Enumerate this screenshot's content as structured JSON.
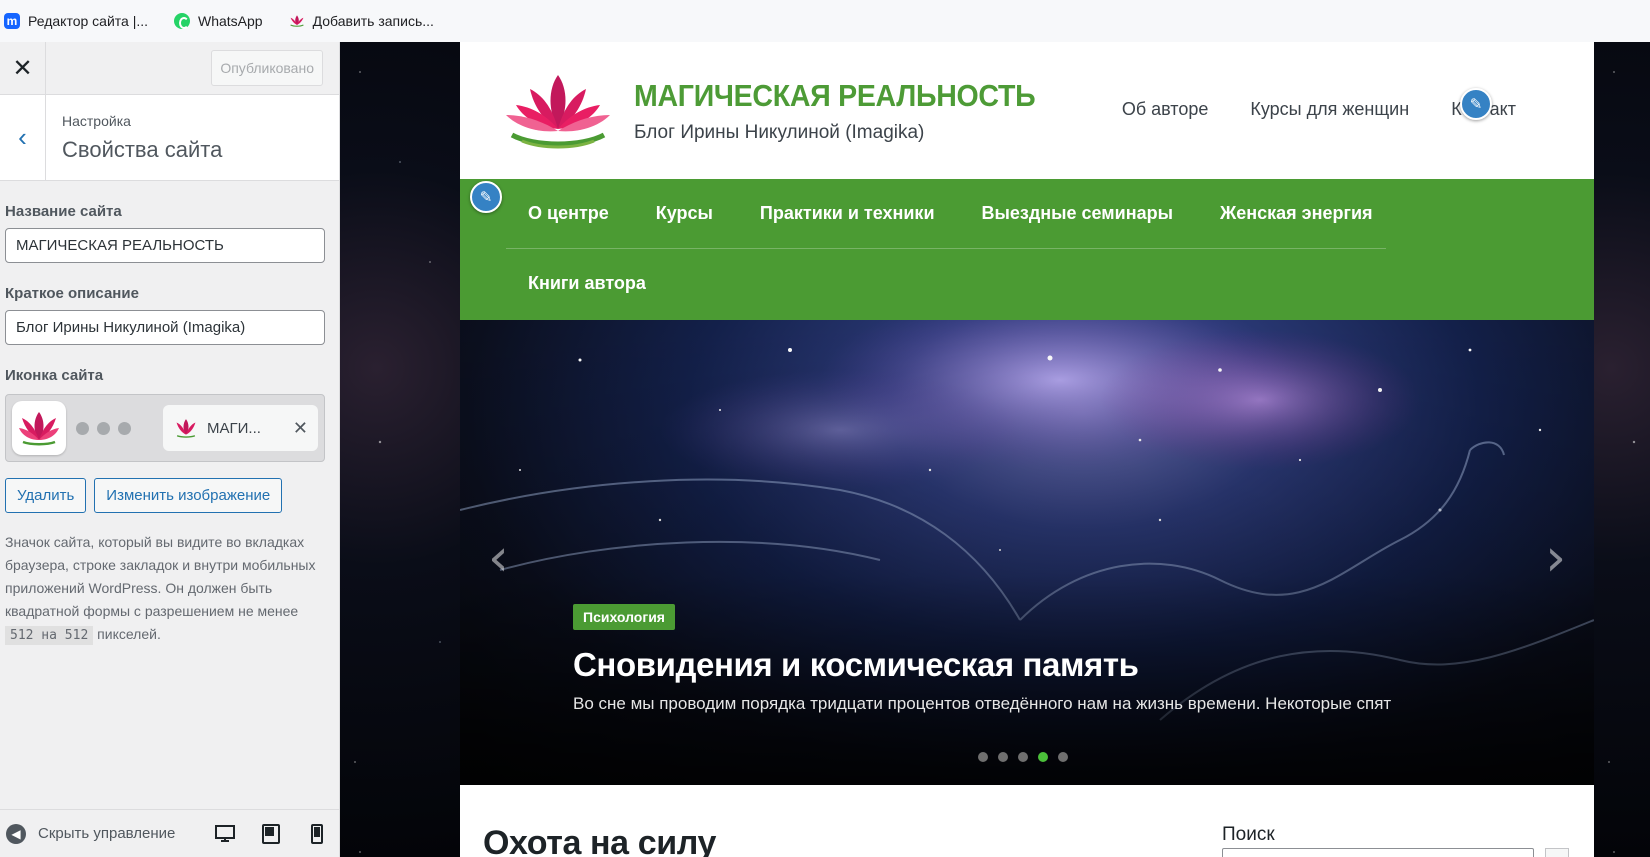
{
  "bookmarks": [
    {
      "label": "Редактор сайта |...",
      "icon": "m-logo-icon"
    },
    {
      "label": "WhatsApp",
      "icon": "whatsapp-icon"
    },
    {
      "label": "Добавить запись...",
      "icon": "lotus-icon"
    }
  ],
  "customizer": {
    "close_icon": "✕",
    "publish_label": "Опубликовано",
    "back_icon": "‹",
    "section_subtitle": "Настройка",
    "section_title": "Свойства сайта",
    "site_title_label": "Название сайта",
    "site_title_value": "МАГИЧЕСКАЯ РЕАЛЬНОСТЬ",
    "tagline_label": "Краткое описание",
    "tagline_value": "Блог Ирины Никулиной (Imagika)",
    "site_icon_label": "Иконка сайта",
    "tab_preview_text": "МАГИ...",
    "tab_close": "✕",
    "remove_label": "Удалить",
    "change_image_label": "Изменить изображение",
    "icon_desc_before": "Значок сайта, который вы видите во вкладках браузера, строке закладок и внутри мобильных приложений WordPress. Он должен быть квадратной формы с разрешением не менее ",
    "icon_desc_code": "512 на 512",
    "icon_desc_after": " пикселей.",
    "hide_controls_label": "Скрыть управление"
  },
  "site": {
    "name": "МАГИЧЕСКАЯ РЕАЛЬНОСТЬ",
    "description": "Блог Ирины Никулиной (Imagika)",
    "top_menu": [
      "Об авторе",
      "Курсы для женщин",
      "Контакт"
    ],
    "main_menu_row1": [
      "О центре",
      "Курсы",
      "Практики и техники",
      "Выездные семинары",
      "Женская энергия"
    ],
    "main_menu_row2": [
      "Книги автора"
    ],
    "slide_category": "Психология",
    "slide_title": "Сновидения и космическая память",
    "slide_excerpt": "Во сне мы проводим порядка тридцати процентов отведённого нам на жизнь времени. Некоторые спят",
    "slide_count": 5,
    "slide_active": 4,
    "content_title": "Охота на силу",
    "search_label": "Поиск"
  },
  "colors": {
    "brand_green": "#4b9b33",
    "title_green": "#4d9b36",
    "wp_blue": "#2271b1",
    "edit_blue": "#3582c4"
  }
}
